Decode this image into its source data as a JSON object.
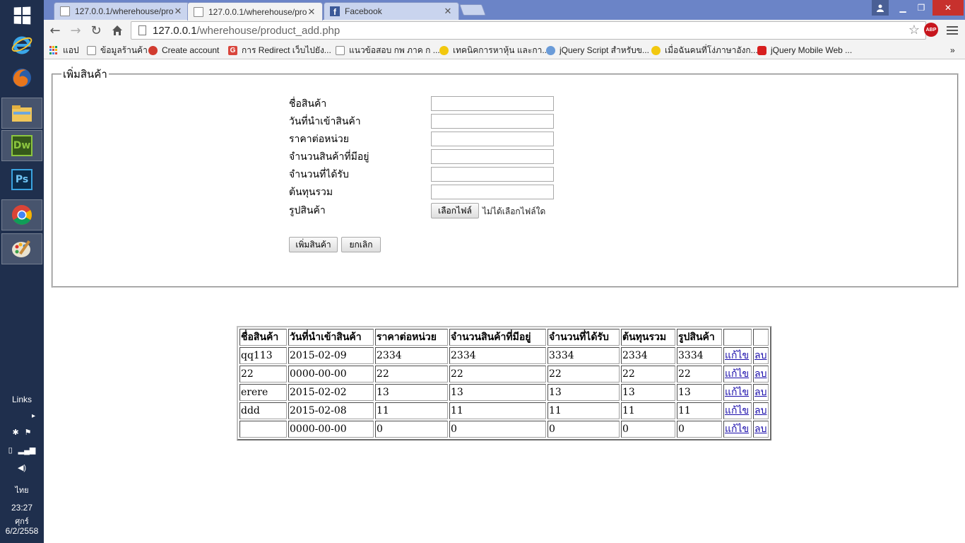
{
  "taskbar": {
    "links_label": "Links",
    "language": "ไทย",
    "time": "23:27",
    "day": "ศุกร์",
    "date": "6/2/2558",
    "apps": [
      "windows-start",
      "internet-explorer",
      "firefox",
      "file-explorer",
      "dreamweaver",
      "photoshop",
      "chrome",
      "paint"
    ],
    "dw_label": "Dw",
    "ps_label": "Ps"
  },
  "browser": {
    "tabs": [
      {
        "title": "127.0.0.1/wherehouse/pro",
        "active": false
      },
      {
        "title": "127.0.0.1/wherehouse/pro",
        "active": true
      },
      {
        "title": "Facebook",
        "active": false
      }
    ],
    "url_host": "127.0.0.1",
    "url_path": "/wherehouse/product_add.php",
    "abp_label": "ABP",
    "bookmarks": [
      {
        "label": "แอป"
      },
      {
        "label": "ข้อมูลร้านค้า"
      },
      {
        "label": "Create account"
      },
      {
        "label": "การ Redirect เว็บไปยัง..."
      },
      {
        "label": "แนวข้อสอบ กพ ภาค ก ..."
      },
      {
        "label": "เทคนิคการหาหุ้น และกา..."
      },
      {
        "label": "jQuery Script สำหรับข..."
      },
      {
        "label": "เมื่อฉันคนที่โง่ภาษาอังก..."
      },
      {
        "label": "jQuery Mobile Web ..."
      }
    ],
    "bookmarks_overflow": "»"
  },
  "form": {
    "legend": "เพิ่มสินค้า",
    "fields": [
      {
        "label": "ชื่อสินค้า",
        "value": ""
      },
      {
        "label": "วันที่นำเข้าสินค้า",
        "value": ""
      },
      {
        "label": "ราคาต่อหน่วย",
        "value": ""
      },
      {
        "label": "จำนวนสินค้าที่มีอยู่",
        "value": ""
      },
      {
        "label": "จำนวนที่ได้รับ",
        "value": ""
      },
      {
        "label": "ต้นทุนรวม",
        "value": ""
      }
    ],
    "image_label": "รูปสินค้า",
    "choose_file_label": "เลือกไฟล์",
    "no_file_text": "ไม่ได้เลือกไฟล์ใด",
    "submit_label": "เพิ่มสินค้า",
    "cancel_label": "ยกเลิก"
  },
  "table": {
    "headers": [
      "ชื่อสินค้า",
      "วันที่นำเข้าสินค้า",
      "ราคาต่อหน่วย",
      "จำนวนสินค้าที่มีอยู่",
      "จำนวนที่ได้รับ",
      "ต้นทุนรวม",
      "รูปสินค้า",
      "",
      ""
    ],
    "edit_label": "แก้ไข",
    "delete_label": "ลบ",
    "rows": [
      [
        "qq113",
        "2015-02-09",
        "2334",
        "2334",
        "3334",
        "2334",
        "3334"
      ],
      [
        "22",
        "0000-00-00",
        "22",
        "22",
        "22",
        "22",
        "22"
      ],
      [
        "erere",
        "2015-02-02",
        "13",
        "13",
        "13",
        "13",
        "13"
      ],
      [
        "ddd",
        "2015-02-08",
        "11",
        "11",
        "11",
        "11",
        "11"
      ],
      [
        "",
        "0000-00-00",
        "0",
        "0",
        "0",
        "0",
        "0"
      ]
    ]
  }
}
